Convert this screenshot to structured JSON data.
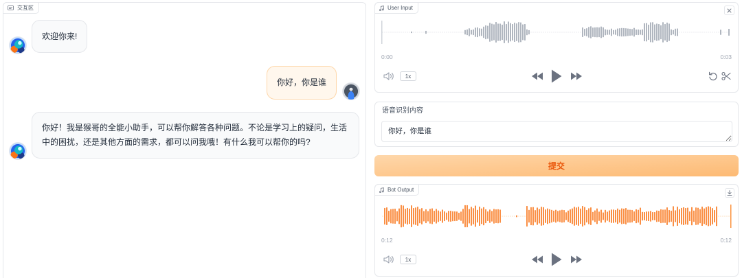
{
  "chat": {
    "label": "交互区",
    "label_icon": "chat-icon",
    "messages": [
      {
        "bot": "欢迎你来!"
      },
      {
        "user": "你好，你是谁"
      },
      {
        "bot": "你好！我是猴哥的全能小助手，可以帮你解答各种问题。不论是学习上的疑问，生活中的困扰，还是其他方面的需求，都可以问我哦！有什么我可以帮你的吗?"
      }
    ]
  },
  "user_input": {
    "label": "User Input",
    "label_icon": "music-note-icon",
    "current_time": "0:00",
    "duration": "0:03",
    "playback_progress": 0,
    "speed": "1x",
    "icons": {
      "close": "close-icon",
      "volume": "volume-icon",
      "rewind": "rewind-icon",
      "play": "play-icon",
      "forward": "forward-icon",
      "undo": "undo-icon",
      "trim": "scissors-icon"
    }
  },
  "transcript": {
    "label": "语音识别内容",
    "value": "你好，你是谁"
  },
  "submit": {
    "label": "提交"
  },
  "bot_output": {
    "label": "Bot Output",
    "label_icon": "music-note-icon",
    "current_time": "0:12",
    "duration": "0:12",
    "playback_progress": 1,
    "speed": "1x",
    "icons": {
      "download": "download-icon",
      "volume": "volume-icon",
      "rewind": "rewind-icon",
      "play": "play-icon",
      "forward": "forward-icon"
    }
  },
  "colors": {
    "border": "#e5e7eb",
    "icon": "#6b7280",
    "bot_bubble": "#f9fafb",
    "user_bubble": "#fff7ed",
    "user_bubble_border": "#fed7aa",
    "submit_gradient_start": "#fed7aa",
    "submit_gradient_end": "#fdba74",
    "submit_text": "#ea580c",
    "input_waveform": "#9ca3af",
    "input_waveform_baseline": "#d1d5db",
    "input_playhead": "#d1d5db",
    "output_waveform": "#f97316",
    "output_waveform_baseline": "#fdba74",
    "output_playhead": "#fb923c"
  }
}
